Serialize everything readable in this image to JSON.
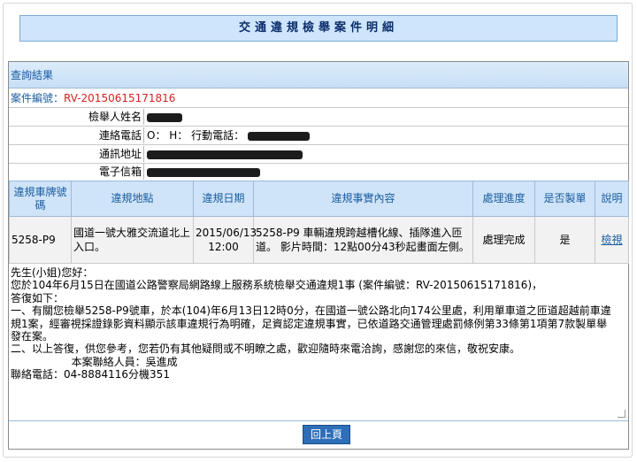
{
  "page_title": "交通違規檢舉案件明細",
  "panel_title": "查詢結果",
  "case": {
    "label": "案件編號：",
    "number": "RV-20150615171816"
  },
  "info": [
    {
      "label": "檢舉人姓名",
      "value": ""
    },
    {
      "label": "連絡電話",
      "value": "O：   H：   行動電話："
    },
    {
      "label": "通訊地址",
      "value": ""
    },
    {
      "label": "電子信箱",
      "value": ""
    }
  ],
  "table": {
    "headers": [
      "違規車牌號碼",
      "違規地點",
      "違規日期",
      "違規事實內容",
      "處理進度",
      "是否製單",
      "說明"
    ],
    "row": {
      "plate": "5258-P9",
      "location": "國道一號大雅交流道北上入口。",
      "date": "2015/06/13 12:00",
      "fact": "5258-P9 車輛違規跨越槽化線、插隊進入匝道。 影片時間：12點00分43秒起畫面左側。",
      "status": "處理完成",
      "ticketed": "是",
      "detail_link": "檢視"
    }
  },
  "reply": "先生(小姐)您好：\n您於104年6月15日在國道公路警察局網路線上服務系統檢舉交通違規1事 (案件編號：RV-20150615171816)，\n答復如下：\n一、有關您檢舉5258-P9號車，於本(104)年6月13日12時0分，在國道一號公路北向174公里處，利用單車道之匝道超越前車違規1案，經審視採證錄影資料顯示該車違規行為明確，足資認定違規事實，已依道路交通管理處罰條例第33條第1項第7款製單舉發在案。\n二、以上答復，供您參考，您若仍有其他疑問或不明瞭之處，歡迎隨時來電洽詢，感謝您的來信，敬祝安康。\n                  本案聯絡人員：吳進成\n聯絡電話：04-8884116分機351",
  "back_button": "回上頁"
}
